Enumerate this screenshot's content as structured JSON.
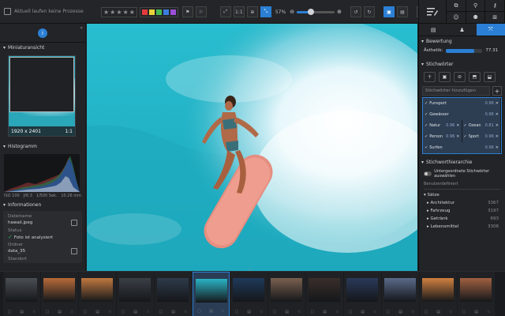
{
  "topbar": {
    "status_text": "Aktuell laufen keine Prozesse",
    "stars": [
      "★",
      "★",
      "★",
      "★",
      "★"
    ],
    "colors": [
      "#e03b3b",
      "#e8d23a",
      "#49b94f",
      "#3b7de0",
      "#9b4fd6"
    ],
    "view_1to1": "1:1",
    "zoom_value": "57%",
    "zoom_fraction": 0.38,
    "close": "✕"
  },
  "left": {
    "thumbnail_header": "Miniaturansicht",
    "dimensions": "1920 x 2401",
    "ratio": "1:1",
    "histogram_header": "Histogramm",
    "iso": "ISO 100",
    "aperture": "ƒ/6.3",
    "shutter": "1/500 Sek.",
    "focal": "10.26 mm",
    "info_header": "Informationen",
    "filename_label": "Dateiname",
    "filename": "hawaii.jpeg",
    "status_label": "Status",
    "status_value": "Foto ist analysiert",
    "folder_label": "Ordner",
    "folder": "data_35",
    "location_label": "Standort"
  },
  "right": {
    "rating_header": "Bewertung",
    "aesthetic_label": "Ästhetik:",
    "aesthetic_value": "77.31",
    "aesthetic_fraction": 0.7731,
    "keywords_header": "Stichwörter",
    "add_placeholder": "Stichwörter hinzufügen",
    "keywords": [
      [
        {
          "name": "Funsport",
          "value": "0.96"
        }
      ],
      [
        {
          "name": "Gewässer",
          "value": "0.96"
        }
      ],
      [
        {
          "name": "Natur",
          "value": "0.96"
        },
        {
          "name": "Ozean",
          "value": "0.81"
        }
      ],
      [
        {
          "name": "Person",
          "value": "0.96"
        },
        {
          "name": "Sport",
          "value": "0.96"
        }
      ],
      [
        {
          "name": "Surfen",
          "value": "0.96"
        }
      ]
    ],
    "hierarchy_header": "Stichworthierarchie",
    "toggle_label": "Untergeordnete Stichwörter auswählen",
    "user_defined": "Benutzerdefiniert",
    "category_group": "Sätze",
    "categories": [
      {
        "name": "Architektur",
        "count": "3367"
      },
      {
        "name": "Fahrzeug",
        "count": "3197"
      },
      {
        "name": "Getränk",
        "count": "693"
      },
      {
        "name": "Lebensmittel",
        "count": "3308"
      }
    ]
  },
  "film": {
    "colors": [
      "#4a4f55",
      "#b86a3a",
      "#c07840",
      "#3a3f46",
      "#2e3a4a",
      "#2bb3c4",
      "#1f3a5a",
      "#7a6050",
      "#3a2e2a",
      "#2a3a5a",
      "#5a6a8a",
      "#d08040",
      "#a06040"
    ]
  }
}
